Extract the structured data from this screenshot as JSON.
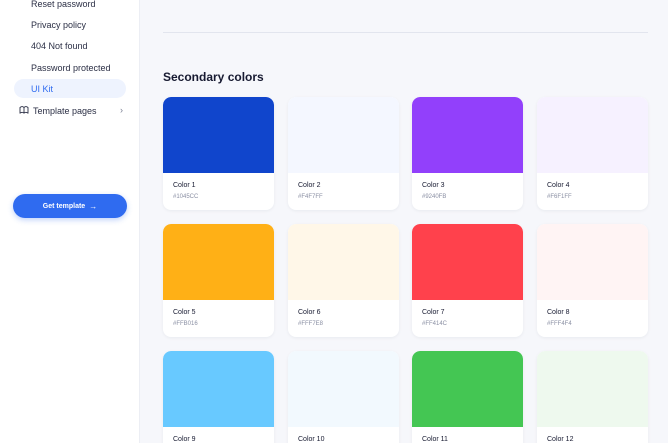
{
  "sidebar": {
    "items": [
      "Reset password",
      "Privacy policy",
      "404 Not found",
      "Password protected"
    ],
    "active_item": "UI Kit",
    "group_label": "Template pages",
    "cta_label": "Get template",
    "accent": "#2F6BF0"
  },
  "main": {
    "section_title": "Secondary colors",
    "colors": [
      {
        "name": "Color 1",
        "hex": "#1045CC",
        "swatch": "#1045CC"
      },
      {
        "name": "Color 2",
        "hex": "#F4F7FF",
        "swatch": "#F4F7FF"
      },
      {
        "name": "Color 3",
        "hex": "#9240FB",
        "swatch": "#9240FB"
      },
      {
        "name": "Color 4",
        "hex": "#F6F1FF",
        "swatch": "#F6F1FF"
      },
      {
        "name": "Color 5",
        "hex": "#FFB016",
        "swatch": "#FFB016"
      },
      {
        "name": "Color 6",
        "hex": "#FFF7E8",
        "swatch": "#FFF7E8"
      },
      {
        "name": "Color 7",
        "hex": "#FF414C",
        "swatch": "#FF414C"
      },
      {
        "name": "Color 8",
        "hex": "#FFF4F4",
        "swatch": "#FFF4F4"
      },
      {
        "name": "Color 9",
        "hex": "",
        "swatch": "#68C9FF"
      },
      {
        "name": "Color 10",
        "hex": "",
        "swatch": "#F2F9FE"
      },
      {
        "name": "Color 11",
        "hex": "",
        "swatch": "#44C653"
      },
      {
        "name": "Color 12",
        "hex": "",
        "swatch": "#EEF9EE"
      }
    ]
  }
}
